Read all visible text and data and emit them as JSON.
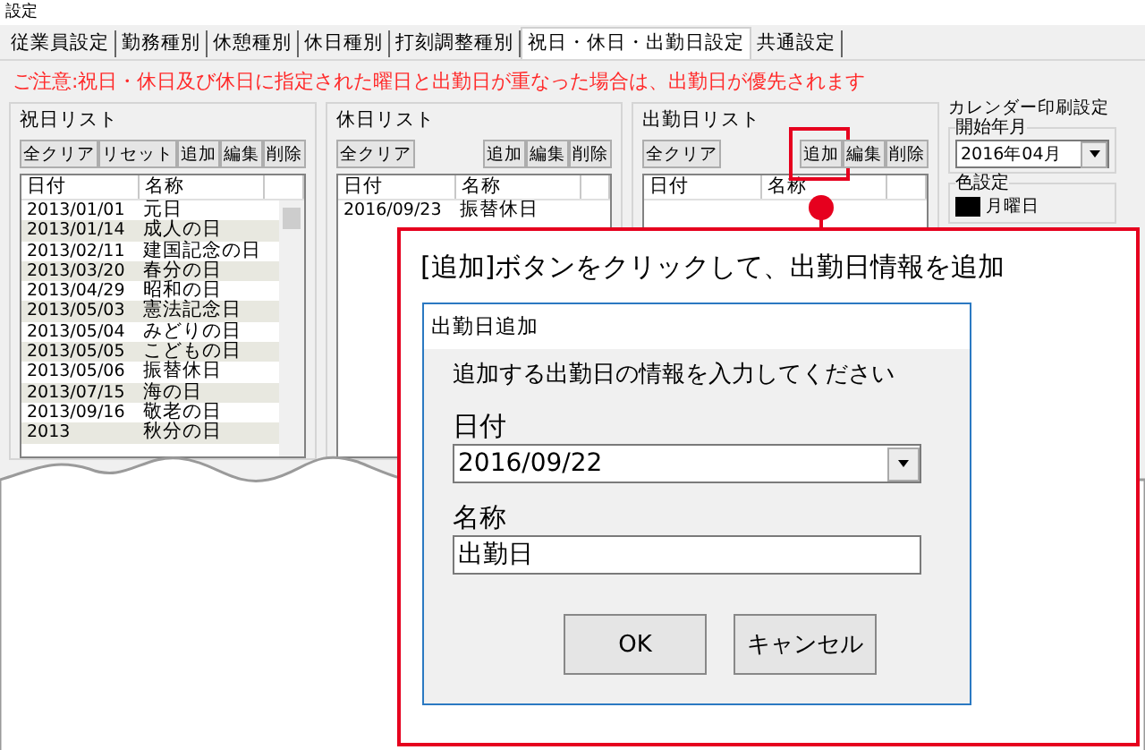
{
  "window": {
    "title": "設定"
  },
  "tabs": [
    {
      "label": "従業員設定",
      "selected": false
    },
    {
      "label": "勤務種別",
      "selected": false
    },
    {
      "label": "休憩種別",
      "selected": false
    },
    {
      "label": "休日種別",
      "selected": false
    },
    {
      "label": "打刻調整種別",
      "selected": false
    },
    {
      "label": "祝日・休日・出勤日設定",
      "selected": true
    },
    {
      "label": "共通設定",
      "selected": false
    }
  ],
  "notice": "ご注意:祝日・休日及び休日に指定された曜日と出勤日が重なった場合は、出勤日が優先されます",
  "lists": [
    {
      "title": "祝日リスト",
      "left_buttons": [
        "全クリア",
        "リセット"
      ],
      "right_buttons": [
        {
          "label": "追加",
          "highlighted": false
        },
        {
          "label": "編集",
          "highlighted": false
        },
        {
          "label": "削除",
          "highlighted": false
        }
      ],
      "columns": [
        "日付",
        "名称"
      ],
      "scrollbar": true,
      "rows": [
        {
          "date": "2013/01/01",
          "name": "元日"
        },
        {
          "date": "2013/01/14",
          "name": "成人の日"
        },
        {
          "date": "2013/02/11",
          "name": "建国記念の日"
        },
        {
          "date": "2013/03/20",
          "name": "春分の日"
        },
        {
          "date": "2013/04/29",
          "name": "昭和の日"
        },
        {
          "date": "2013/05/03",
          "name": "憲法記念日"
        },
        {
          "date": "2013/05/04",
          "name": "みどりの日"
        },
        {
          "date": "2013/05/05",
          "name": "こどもの日"
        },
        {
          "date": "2013/05/06",
          "name": "振替休日"
        },
        {
          "date": "2013/07/15",
          "name": "海の日"
        },
        {
          "date": "2013/09/16",
          "name": "敬老の日"
        },
        {
          "date": "2013",
          "name": "秋分の日"
        }
      ]
    },
    {
      "title": "休日リスト",
      "left_buttons": [
        "全クリア"
      ],
      "right_buttons": [
        {
          "label": "追加",
          "highlighted": false
        },
        {
          "label": "編集",
          "highlighted": false
        },
        {
          "label": "削除",
          "highlighted": false
        }
      ],
      "columns": [
        "日付",
        "名称"
      ],
      "scrollbar": false,
      "rows": [
        {
          "date": "2016/09/23",
          "name": "振替休日"
        }
      ]
    },
    {
      "title": "出勤日リスト",
      "left_buttons": [
        "全クリア"
      ],
      "right_buttons": [
        {
          "label": "追加",
          "highlighted": true
        },
        {
          "label": "編集",
          "highlighted": false
        },
        {
          "label": "削除",
          "highlighted": false
        }
      ],
      "columns": [
        "日付",
        "名称"
      ],
      "scrollbar": false
    }
  ],
  "calendar_print": {
    "title": "カレンダー印刷設定",
    "start_label": "開始年月",
    "start_value": "2016年04月",
    "color_label": "色設定",
    "colors": [
      {
        "label": "月曜日",
        "color": "#000000"
      }
    ]
  },
  "callout": {
    "caption": "[追加]ボタンをクリックして、出勤日情報を追加",
    "dialog": {
      "title": "出勤日追加",
      "prompt": "追加する出勤日の情報を入力してください",
      "date_label": "日付",
      "date_value": "2016/09/22",
      "name_label": "名称",
      "name_value": "出勤日",
      "buttons": [
        "OK",
        "キャンセル"
      ]
    }
  }
}
